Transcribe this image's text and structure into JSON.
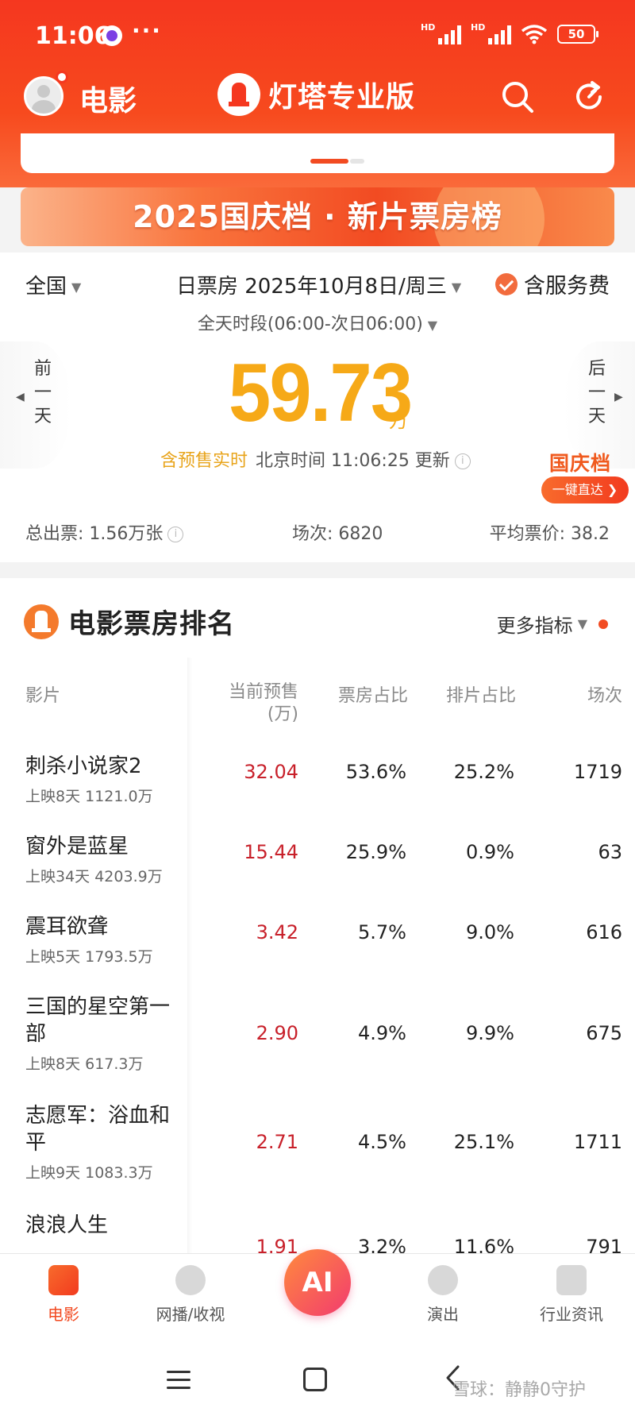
{
  "status_bar": {
    "time": "11:06",
    "more": "···",
    "signal1_label": "HD",
    "signal2_label": "HD",
    "battery": "50"
  },
  "top_nav": {
    "section": "电影",
    "brand": "灯塔专业版",
    "icons": [
      "search-icon",
      "refresh-icon"
    ]
  },
  "banner": {
    "text": "2025国庆档 · 新片票房榜"
  },
  "summary": {
    "region": "全国",
    "date": "日票房 2025年10月8日/周三",
    "service_fee": "含服务费",
    "time_range": "全天时段(06:00-次日06:00)",
    "prev_day": "前一天",
    "next_day": "后一天",
    "box_office": "59.73",
    "box_office_unit": "万",
    "presale_label": "含预售实时",
    "update_text": "北京时间 11:06:25 更新",
    "holiday_title": "国庆档",
    "holiday_button": "一键直达",
    "total_tickets": "总出票: 1.56万张",
    "shows": "场次: 6820",
    "avg_price": "平均票价: 38.2"
  },
  "ranking": {
    "title": "电影票房排名",
    "more_metrics": "更多指标",
    "columns": {
      "film": "影片",
      "presale": "当前预售",
      "presale_unit": "(万)",
      "share": "票房占比",
      "schedule": "排片占比",
      "shows": "场次"
    },
    "rows": [
      {
        "name": "刺杀小说家2",
        "meta": "上映8天 1121.0万",
        "presale": "32.04",
        "share": "53.6%",
        "schedule": "25.2%",
        "shows": "1719"
      },
      {
        "name": "窗外是蓝星",
        "meta": "上映34天 4203.9万",
        "presale": "15.44",
        "share": "25.9%",
        "schedule": "0.9%",
        "shows": "63"
      },
      {
        "name": "震耳欲聋",
        "meta": "上映5天 1793.5万",
        "presale": "3.42",
        "share": "5.7%",
        "schedule": "9.0%",
        "shows": "616"
      },
      {
        "name": "三国的星空第一部",
        "meta": "上映8天 617.3万",
        "presale": "2.90",
        "share": "4.9%",
        "schedule": "9.9%",
        "shows": "675"
      },
      {
        "name": "志愿军：浴血和平",
        "meta": "上映9天 1083.3万",
        "presale": "2.71",
        "share": "4.5%",
        "schedule": "25.1%",
        "shows": "1711"
      },
      {
        "name": "浪浪人生",
        "meta": "",
        "presale": "1.91",
        "share": "3.2%",
        "schedule": "11.6%",
        "shows": "791"
      }
    ]
  },
  "tabbar": {
    "movie": "电影",
    "web": "网播/收视",
    "ai": "AI",
    "show": "演出",
    "news": "行业资讯"
  },
  "watermark": "雪球：静静0守护",
  "colors": {
    "brand_red": "#f5371f",
    "box_office_gold": "#f6a917",
    "presale_red": "#c8202a"
  }
}
